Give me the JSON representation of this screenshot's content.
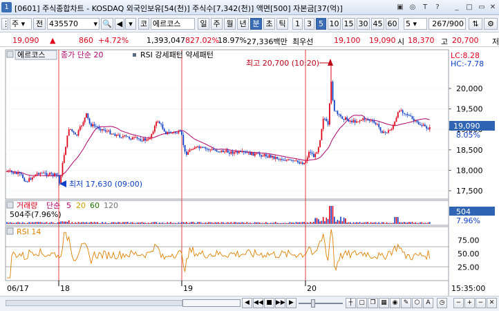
{
  "window": {
    "icon_label": "1",
    "title": "[0601] 주식종합차트 - KOSDAQ 외국인보유[54(천)] 주식수[7,342(천)] 액면[500] 자본금[37(억)]"
  },
  "toolbar": {
    "market_select": "주",
    "prev_label": "전",
    "code": "435570",
    "market_badge": "코",
    "stock_name": "에르코스",
    "periods": [
      "일",
      "주",
      "월",
      "년",
      "분",
      "초",
      "틱"
    ],
    "selected_period": "분",
    "intervals": [
      "1",
      "3",
      "5",
      "10",
      "15",
      "30",
      "45",
      "60"
    ],
    "selected_interval": "5",
    "count_value": "5",
    "page_count": "267/900"
  },
  "quote": {
    "price": "19,090",
    "change": "860",
    "change_pct": "+4.72%",
    "volume": "1,393,047",
    "vol_ratio": "827.02%",
    "turnover": "18.97%",
    "amount": "27,336백만",
    "best_label": "최우선",
    "ask": "19,100",
    "bid": "19,090",
    "open_label": "시",
    "open": "18,370",
    "high_label": "고",
    "high": "20,700"
  },
  "price_panel": {
    "stock_tag": "에르코스",
    "ma_label": "종가 단순 20",
    "indicator_label": "RSI 강세패턴  약세패턴",
    "lc_label": "LC:8.28",
    "hc_label": "HC:-7.78",
    "high_annotation": "최고 20,700 (10:20)",
    "low_annotation": "최저 17,630 (09:00)",
    "current_price": "19,090",
    "current_pct": "8.05%",
    "y_ticks": [
      "20,000",
      "19,500",
      "19,000",
      "18,500",
      "18,000",
      "17,500"
    ]
  },
  "volume_panel": {
    "label": "거래량",
    "ma_label": "단순",
    "ma_periods": [
      "5",
      "20",
      "60",
      "120"
    ],
    "value_text": "504주(7.96%)",
    "right_value": "504",
    "right_pct": "7.96%"
  },
  "rsi_panel": {
    "label": "RSI 14",
    "y_ticks": [
      "75.00",
      "50.00",
      "25.00"
    ]
  },
  "xaxis": {
    "labels": [
      "06/17",
      "18",
      "19",
      "20"
    ],
    "time": "15:35:00"
  },
  "colors": {
    "up": "#e0001a",
    "down": "#1040c8",
    "ma": "#b0006a",
    "rsi": "#e08000",
    "select": "#2f63b3",
    "separator": "#e04040"
  }
}
